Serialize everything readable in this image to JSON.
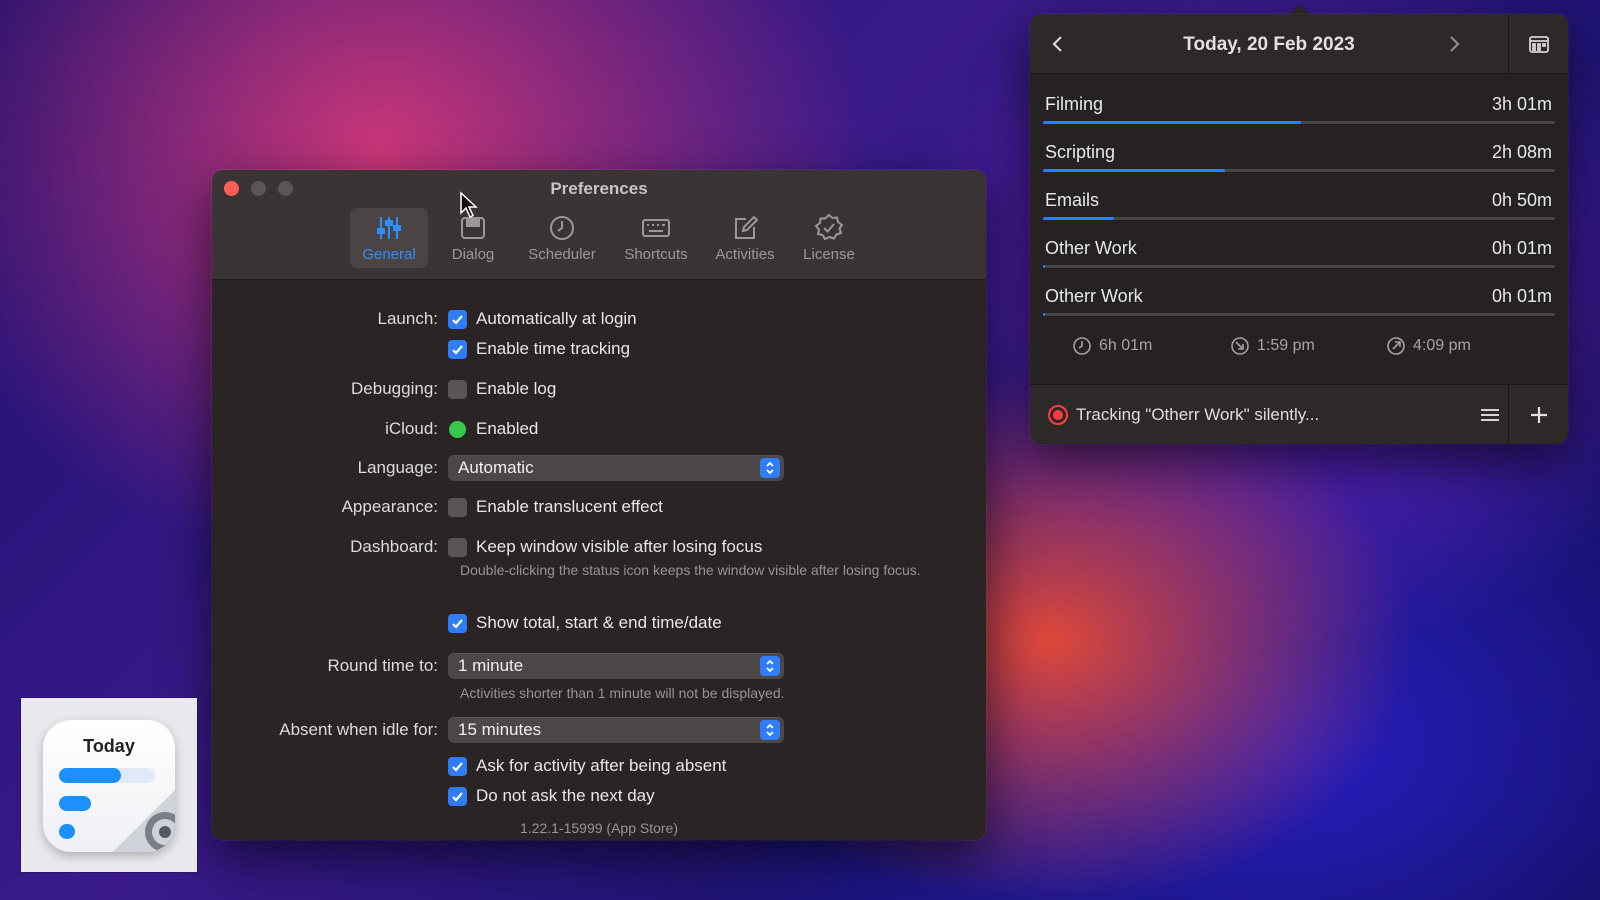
{
  "preferences": {
    "title": "Preferences",
    "tabs": [
      {
        "label": "General",
        "icon": "sliders-icon",
        "active": true
      },
      {
        "label": "Dialog",
        "icon": "dialog-window-icon",
        "active": false
      },
      {
        "label": "Scheduler",
        "icon": "clock-icon",
        "active": false
      },
      {
        "label": "Shortcuts",
        "icon": "keyboard-icon",
        "active": false
      },
      {
        "label": "Activities",
        "icon": "edit-square-icon",
        "active": false
      },
      {
        "label": "License",
        "icon": "seal-check-icon",
        "active": false
      }
    ],
    "launch": {
      "label": "Launch:",
      "auto_login": {
        "text": "Automatically at login",
        "checked": true
      },
      "time_tracking": {
        "text": "Enable time tracking",
        "checked": true
      }
    },
    "debugging": {
      "label": "Debugging:",
      "enable_log": {
        "text": "Enable log",
        "checked": false
      }
    },
    "icloud": {
      "label": "iCloud:",
      "status": "Enabled",
      "status_color": "#38c84a"
    },
    "language": {
      "label": "Language:",
      "value": "Automatic"
    },
    "appearance": {
      "label": "Appearance:",
      "translucent": {
        "text": "Enable translucent effect",
        "checked": false
      }
    },
    "dashboard": {
      "label": "Dashboard:",
      "keep_visible": {
        "text": "Keep window visible after losing focus",
        "checked": false
      },
      "hint": "Double-clicking the status icon keeps the window visible after losing focus.",
      "show_total": {
        "text": "Show total, start & end time/date",
        "checked": true
      }
    },
    "round_time": {
      "label": "Round time to:",
      "value": "1 minute",
      "hint": "Activities shorter than 1 minute will not be displayed."
    },
    "absent_idle": {
      "label": "Absent when idle for:",
      "value": "15 minutes",
      "ask_after_absent": {
        "text": "Ask for activity after being absent",
        "checked": true
      },
      "not_next_day": {
        "text": "Do not ask the next day",
        "checked": true
      }
    },
    "version": "1.22.1-15999 (App Store)"
  },
  "dashboard_popover": {
    "date_title": "Today, 20 Feb 2023",
    "activities": [
      {
        "name": "Filming",
        "duration": "3h 01m",
        "fraction": 0.503
      },
      {
        "name": "Scripting",
        "duration": "2h 08m",
        "fraction": 0.356
      },
      {
        "name": "Emails",
        "duration": "0h 50m",
        "fraction": 0.139
      },
      {
        "name": "Other Work",
        "duration": "0h 01m",
        "fraction": 0.003
      },
      {
        "name": "Otherr Work",
        "duration": "0h 01m",
        "fraction": 0.003
      }
    ],
    "stats": {
      "total": "6h 01m",
      "start": "1:59 pm",
      "end": "4:09 pm"
    },
    "tracking_text": "Tracking \"Otherr Work\" silently..."
  },
  "app_icon": {
    "title": "Today"
  },
  "colors": {
    "accent": "#2f7df6",
    "record": "#ff3b3b",
    "close": "#ff5f57"
  }
}
